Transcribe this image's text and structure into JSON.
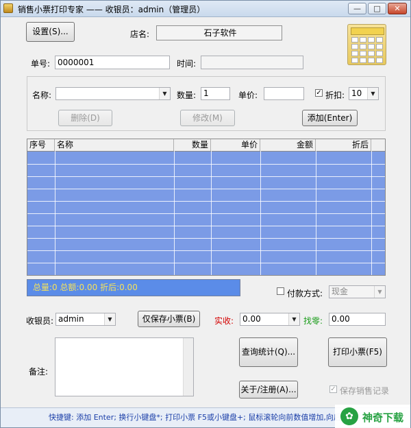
{
  "window": {
    "title": "销售小票打印专家      —— 收银员：admin（管理员）",
    "minimize_glyph": "—",
    "maximize_glyph": "□",
    "close_glyph": "✕"
  },
  "header": {
    "settings_button": "设置(S)...",
    "store_label": "店名:",
    "store_name": "石子软件",
    "order_no_label": "单号:",
    "order_no": "0000001",
    "time_label": "时间:",
    "time_value": ""
  },
  "entry": {
    "name_label": "名称:",
    "name_value": "",
    "qty_label": "数量:",
    "qty_value": "1",
    "price_label": "单价:",
    "price_value": "",
    "discount_checked": true,
    "discount_label": "折扣:",
    "discount_value": "10",
    "delete_button": "删除(D)",
    "modify_button": "修改(M)",
    "add_button": "添加(Enter)"
  },
  "table": {
    "columns": [
      "序号",
      "名称",
      "数量",
      "单价",
      "金额",
      "折后"
    ],
    "rows": []
  },
  "summary": {
    "text": "总量:0  总额:0.00  折后:0.00"
  },
  "payment": {
    "label": "付款方式:",
    "checked": false,
    "method": "现金"
  },
  "cashier": {
    "label": "收银员:",
    "value": "admin",
    "save_only_button": "仅保存小票(B)",
    "received_label": "实收:",
    "received_value": "0.00",
    "change_label": "找零:",
    "change_value": "0.00",
    "received_color": "#d40000",
    "change_color": "#1a9c1a"
  },
  "notes": {
    "label": "备注:",
    "value": ""
  },
  "actions": {
    "query_button": "查询统计(Q)...",
    "print_button": "打印小票(F5)",
    "about_button": "关于/注册(A)...",
    "save_record_label": "保存销售记录",
    "save_record_checked": true
  },
  "statusbar": {
    "text": "快捷键: 添加 Enter; 换行小键盘*; 打印小票 F5或小键盘+; 鼠标滚轮向前数值增加,向后减少"
  },
  "watermark": {
    "text": "神奇下载"
  },
  "colors": {
    "grid_fill": "#7b9be6",
    "summary_fill": "#5b8ce8",
    "summary_text": "#f5e25b",
    "status_text": "#1a3ea8"
  }
}
